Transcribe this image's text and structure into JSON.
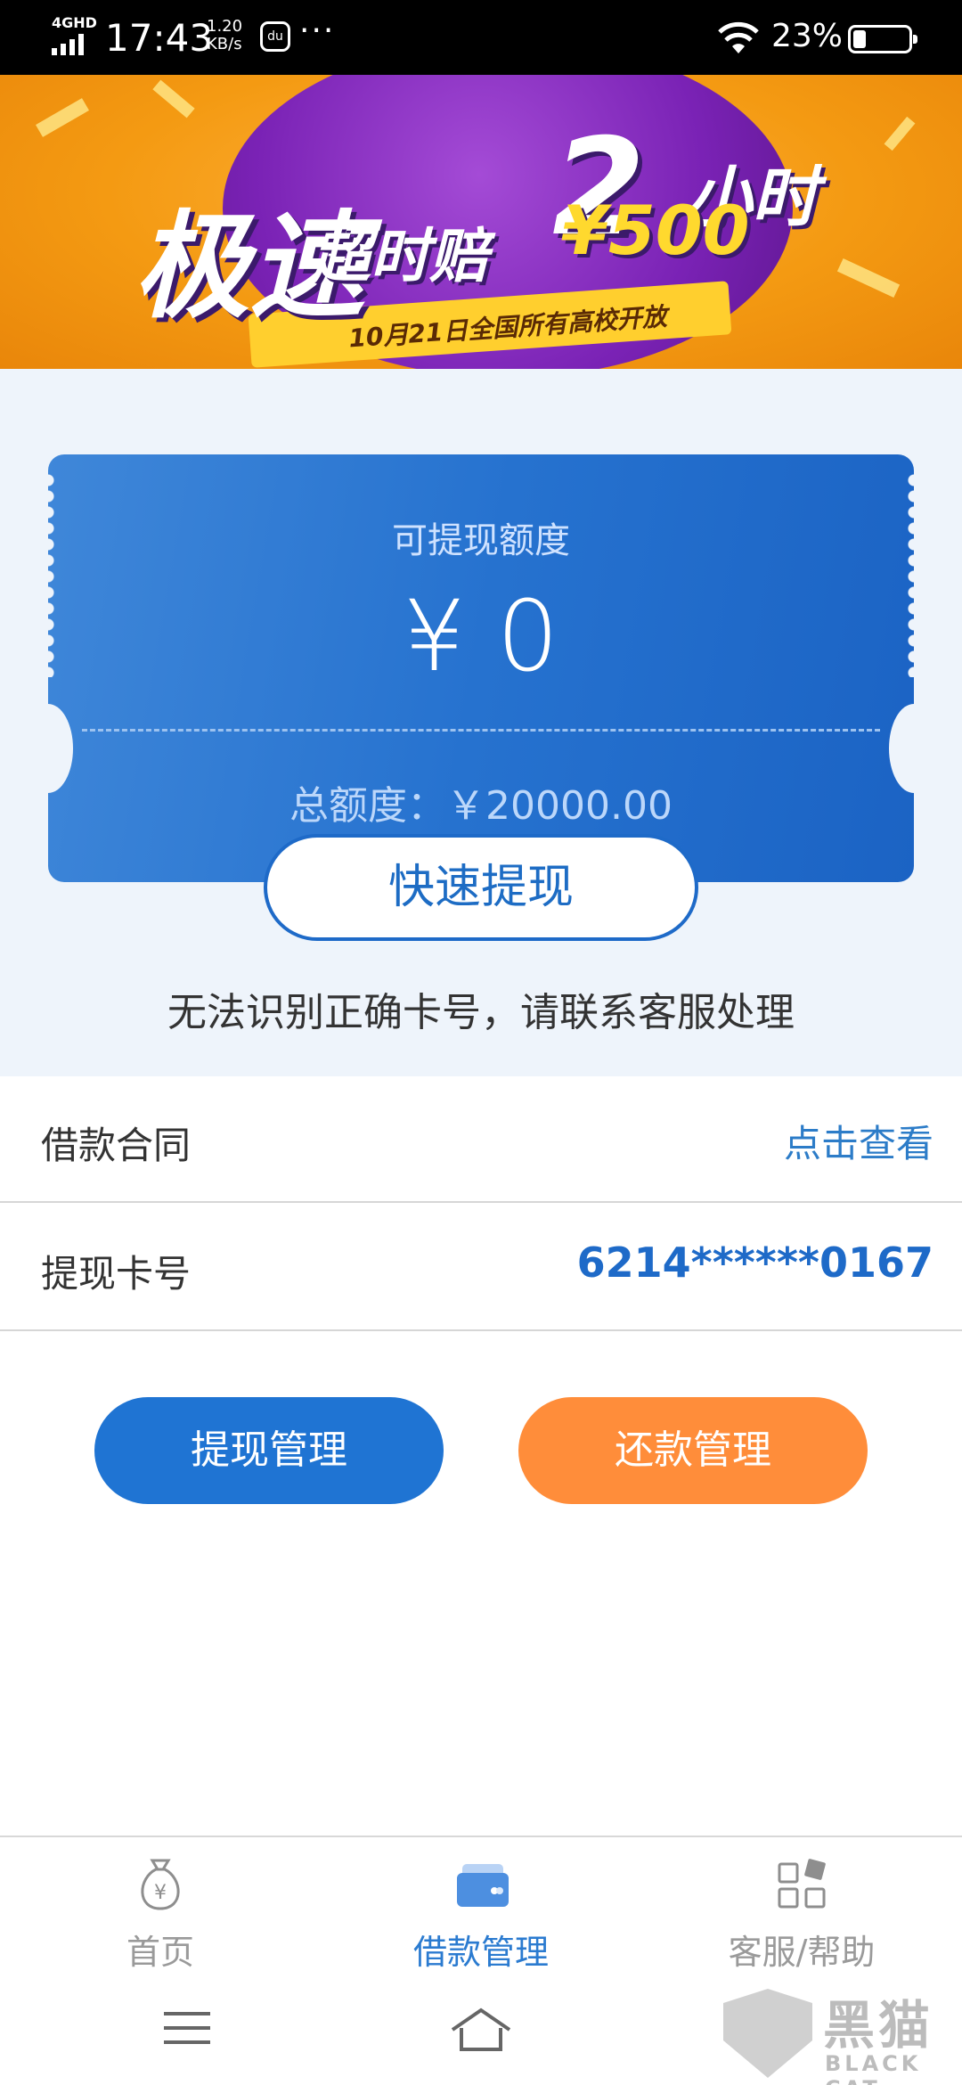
{
  "status_bar": {
    "network": "4GHD",
    "time": "17:43",
    "speed_value": "1.20",
    "speed_unit": "KB/s",
    "app_icon_text": "du",
    "more": "···",
    "battery_percent": "23%",
    "battery_level": 0.23
  },
  "banner": {
    "title_big": "极速",
    "title_number": "2",
    "title_unit": "小时",
    "title_sub": "超时赔",
    "price": "¥500",
    "subtitle": "10月21日全国所有高校开放"
  },
  "quota_card": {
    "label": "可提现额度",
    "amount": "¥ 0",
    "total": "总额度：￥20000.00",
    "withdraw_button": "快速提现"
  },
  "notice": "无法识别正确卡号，请联系客服处理",
  "rows": [
    {
      "label": "借款合同",
      "value": "点击查看"
    },
    {
      "label": "提现卡号",
      "value": "6214******0167"
    }
  ],
  "actions": {
    "withdraw_manage": "提现管理",
    "repay_manage": "还款管理"
  },
  "tabs": [
    {
      "label": "首页",
      "icon": "money-bag-icon",
      "active": false
    },
    {
      "label": "借款管理",
      "icon": "card-stack-icon",
      "active": true
    },
    {
      "label": "客服/帮助",
      "icon": "grid-apps-icon",
      "active": false
    }
  ],
  "colors": {
    "primary": "#1f74d3",
    "accent": "#ff8d3a",
    "link": "#2c7cc8"
  },
  "watermark": {
    "cn": "黑猫",
    "en": "BLACK CAT"
  }
}
